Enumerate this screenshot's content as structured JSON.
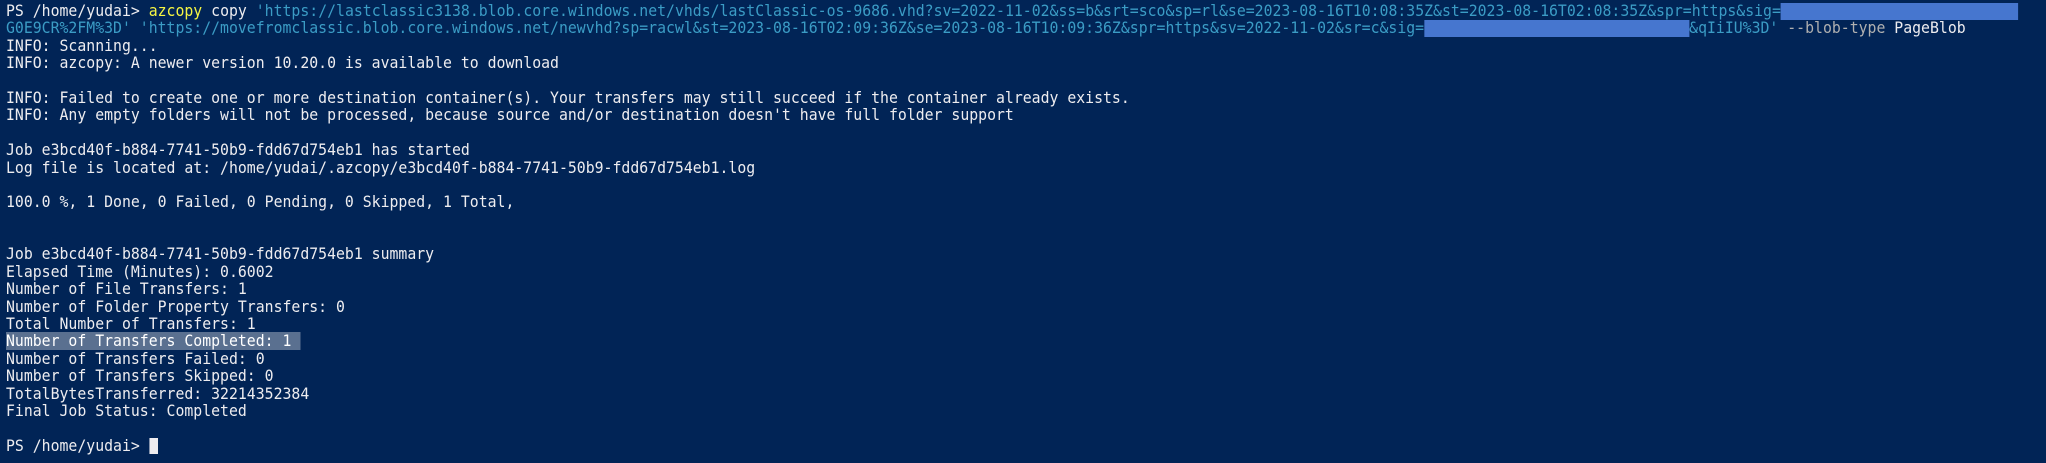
{
  "colors": {
    "background": "#012456",
    "foreground": "#eeedf0",
    "command": "#f5f543",
    "string": "#3b9cc5",
    "redaction": "#4676cf",
    "selection": "#5a7090"
  },
  "command": {
    "prompt": "PS /home/yudai> ",
    "exe": "azcopy",
    "verb": " copy ",
    "source_url": "'https://lastclassic3138.blob.core.windows.net/vhds/lastClassic-os-9686.vhd?sv=2022-11-02&ss=b&srt=sco&sp=rl&se=2023-08-16T10:08:35Z&st=2023-08-16T02:08:35Z&spr=https&sig=",
    "source_tail": "G0E9CR%2FM%3D'",
    "dest_url": " 'https://movefromclassic.blob.core.windows.net/newvhd?sp=racwl&st=2023-08-16T02:09:36Z&se=2023-08-16T10:09:36Z&spr=https&sv=2022-11-02&sr=c&sig=",
    "dest_tail": "&qIiIU%3D'",
    "param": " --blob-type",
    "param_value": " PageBlob"
  },
  "output": {
    "scanning": "INFO: Scanning...",
    "newer_version": "INFO: azcopy: A newer version 10.20.0 is available to download",
    "failed_container": "INFO: Failed to create one or more destination container(s). Your transfers may still succeed if the container already exists.",
    "empty_folders": "INFO: Any empty folders will not be processed, because source and/or destination doesn't have full folder support",
    "job_started": "Job e3bcd40f-b884-7741-50b9-fdd67d754eb1 has started",
    "log_file": "Log file is located at: /home/yudai/.azcopy/e3bcd40f-b884-7741-50b9-fdd67d754eb1.log",
    "progress": "100.0 %, 1 Done, 0 Failed, 0 Pending, 0 Skipped, 1 Total,",
    "summary_header": "Job e3bcd40f-b884-7741-50b9-fdd67d754eb1 summary",
    "summary": [
      "Elapsed Time (Minutes): 0.6002",
      "Number of File Transfers: 1",
      "Number of Folder Property Transfers: 0",
      "Total Number of Transfers: 1",
      "Number of Transfers Completed: 1 ",
      "Number of Transfers Failed: 0",
      "Number of Transfers Skipped: 0",
      "TotalBytesTransferred: 32214352384",
      "Final Job Status: Completed"
    ]
  },
  "final_prompt": "PS /home/yudai> "
}
